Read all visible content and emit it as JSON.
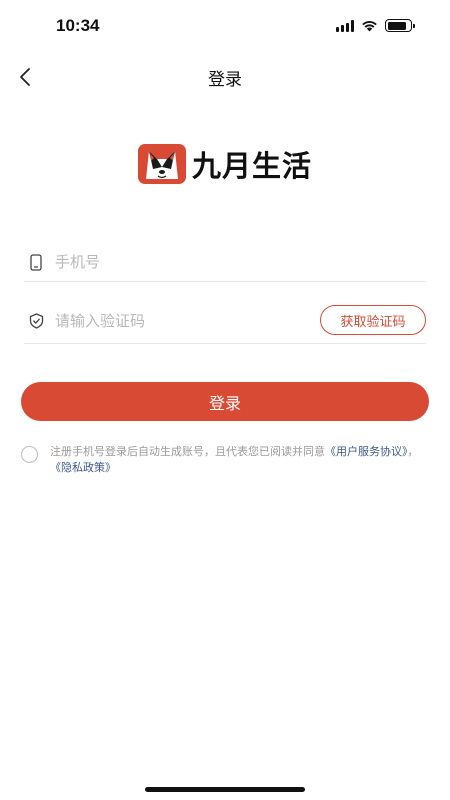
{
  "status_bar": {
    "time": "10:34",
    "icons": [
      "cellular-signal-icon",
      "wifi-icon",
      "battery-icon"
    ]
  },
  "nav": {
    "title": "登录",
    "back_icon": "chevron-left-icon"
  },
  "brand": {
    "logo_icon": "husky-dog-logo-icon",
    "name": "九月生活",
    "logo_color": "#d94a34"
  },
  "form": {
    "phone": {
      "icon": "phone-icon",
      "value": "",
      "placeholder": "手机号"
    },
    "code": {
      "icon": "shield-check-icon",
      "value": "",
      "placeholder": "请输入验证码",
      "get_code_label": "获取验证码"
    },
    "login_label": "登录"
  },
  "agreement": {
    "checked": false,
    "text": "注册手机号登录后自动生成账号，且代表您已阅读并同意",
    "user_agreement": "《用户服务协议》",
    "separator": "，",
    "privacy_policy": "《隐私政策》"
  },
  "colors": {
    "accent": "#d94a34",
    "link": "#3d5a8a",
    "placeholder": "#b8b8b8"
  }
}
